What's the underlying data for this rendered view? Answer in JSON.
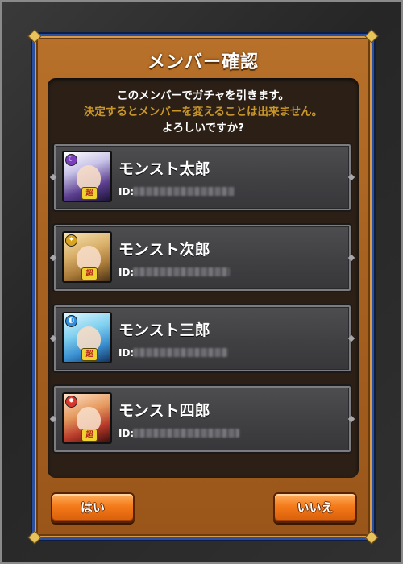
{
  "dialog": {
    "title": "メンバー確認",
    "message_line1": "このメンバーでガチャを引きます。",
    "message_line2": "決定するとメンバーを変えることは出来ません。",
    "message_line3": "よろしいですか?",
    "accent_color": "#c9962a"
  },
  "members": [
    {
      "name": "モンスト太郎",
      "id_label": "ID:",
      "attribute": "dark-attribute-icon",
      "rank_badge": "超"
    },
    {
      "name": "モンスト次郎",
      "id_label": "ID:",
      "attribute": "light-attribute-icon",
      "rank_badge": "超"
    },
    {
      "name": "モンスト三郎",
      "id_label": "ID:",
      "attribute": "water-attribute-icon",
      "rank_badge": "超"
    },
    {
      "name": "モンスト四郎",
      "id_label": "ID:",
      "attribute": "fire-attribute-icon",
      "rank_badge": "超"
    }
  ],
  "buttons": {
    "yes_label": "はい",
    "no_label": "いいえ",
    "color": "#f47a1a"
  }
}
